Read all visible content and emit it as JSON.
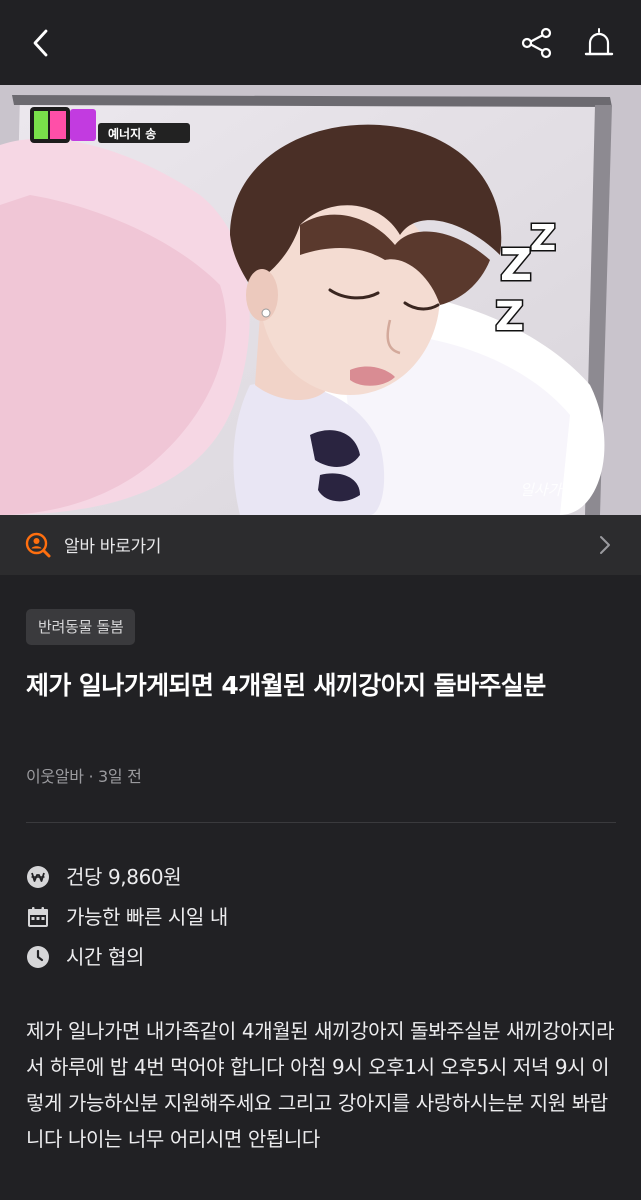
{
  "header": {
    "back_icon": "chevron-left-icon",
    "share_icon": "share-icon",
    "report_icon": "siren-icon"
  },
  "photo": {
    "caption_logo": "예너지 송",
    "watermark": "일사가지원"
  },
  "shortcut": {
    "icon": "search-person-icon",
    "label": "알바 바로가기",
    "chevron_icon": "chevron-right-icon",
    "accent_color": "#ff6f0f"
  },
  "post": {
    "category": "반려동물 돌봄",
    "title": "제가 일나가게되면 4개월된 새끼강아지 돌바주실분",
    "author": "이웃알바",
    "time": "3일 전",
    "info": {
      "wage": "건당 9,860원",
      "date": "가능한 빠른 시일 내",
      "hours": "시간 협의"
    },
    "description": "제가 일나가면 내가족같이 4개월된 새끼강아지 돌봐주실분 새끼강아지라서 하루에 밥 4번 먹어야 합니다 아침 9시 오후1시 오후5시 저녁 9시 이렇게 가능하신분 지원해주세요 그리고 강아지를 사랑하시는분 지원 봐랍니다 나이는 너무 어리시면 안됩니다"
  }
}
